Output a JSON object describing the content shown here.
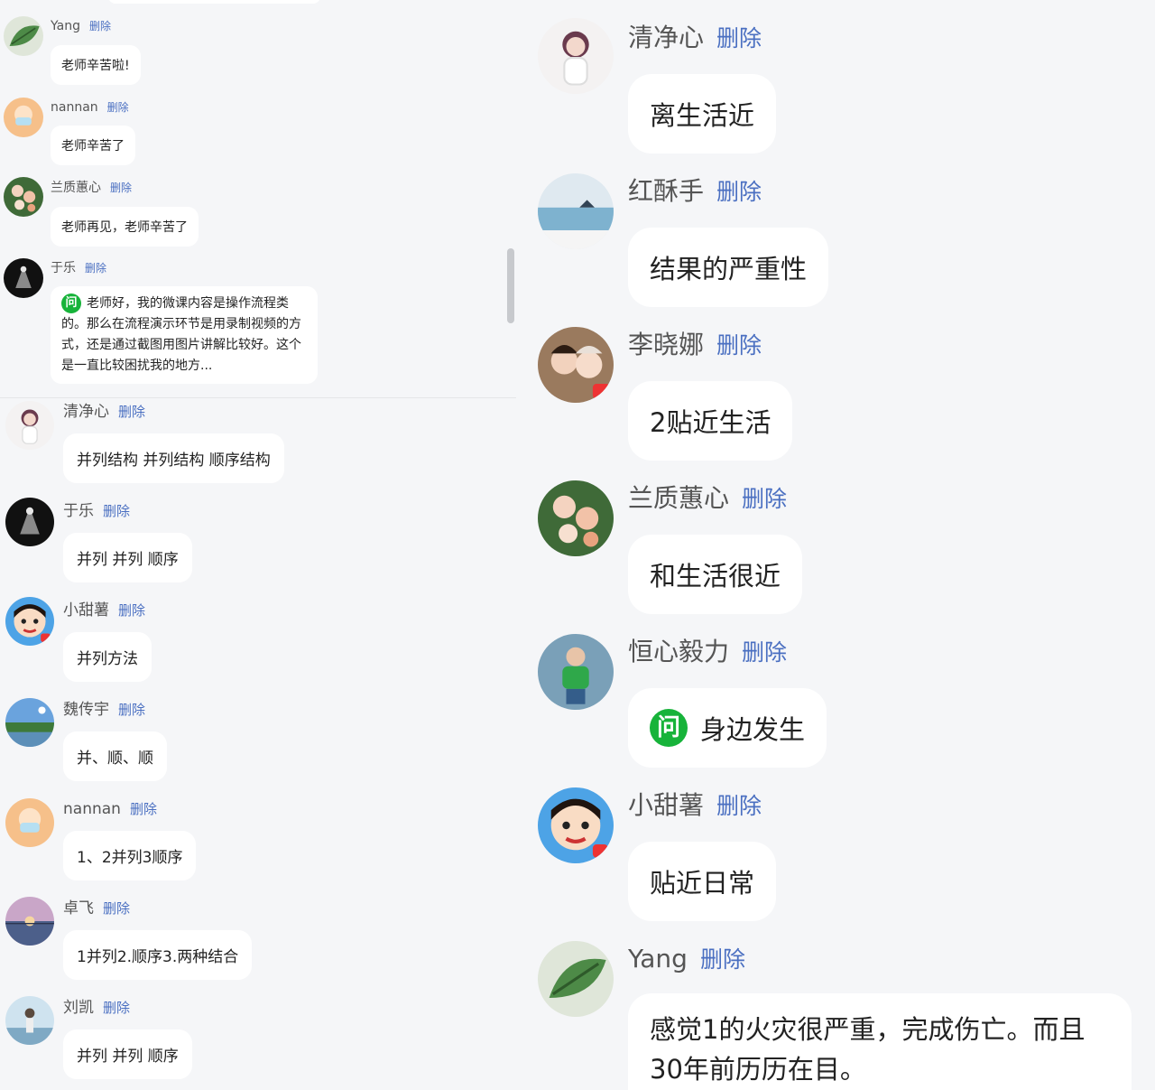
{
  "left_top": [
    {
      "user": "Yang",
      "text": "老师辛苦啦!",
      "avatar": "leaf-avatar"
    },
    {
      "user": "nannan",
      "text": "老师辛苦了",
      "avatar": "mask-avatar"
    },
    {
      "user": "兰质蕙心",
      "text": "老师再见，老师辛苦了",
      "avatar": "flower-avatar"
    },
    {
      "user": "于乐",
      "question_icon": "问",
      "text": "老师好，我的微课内容是操作流程类的。那么在流程演示环节是用录制视频的方式，还是通过截图用图片讲解比较好。这个是一直比较困扰我的地方...",
      "avatar": "dark-avatar"
    }
  ],
  "left_bottom": [
    {
      "user": "清净心",
      "text": "并列结构 并列结构 顺序结构",
      "avatar": "girl-avatar"
    },
    {
      "user": "于乐",
      "text": "并列 并列 顺序",
      "avatar": "dark-avatar"
    },
    {
      "user": "小甜薯",
      "text": "并列方法",
      "avatar": "cartoon-avatar"
    },
    {
      "user": "魏传宇",
      "text": "并、顺、顺",
      "avatar": "landscape-avatar"
    },
    {
      "user": "nannan",
      "text": "1、2并列3顺序",
      "avatar": "mask-avatar"
    },
    {
      "user": "卓飞",
      "text": "1并列2.顺序3.两种结合",
      "avatar": "sunset-avatar"
    },
    {
      "user": "刘凯",
      "text": "并列 并列 顺序",
      "avatar": "person-avatar"
    }
  ],
  "right": [
    {
      "user": "清净心",
      "text": "离生活近",
      "avatar": "girl-avatar"
    },
    {
      "user": "红酥手",
      "text": "结果的严重性",
      "avatar": "sea-avatar"
    },
    {
      "user": "李晓娜",
      "text": "2贴近生活",
      "avatar": "family-avatar"
    },
    {
      "user": "兰质蕙心",
      "text": "和生活很近",
      "avatar": "flower-avatar"
    },
    {
      "user": "恒心毅力",
      "question_icon": "问",
      "text": "身边发生",
      "avatar": "child-avatar"
    },
    {
      "user": "小甜薯",
      "text": "贴近日常",
      "avatar": "cartoon-avatar"
    },
    {
      "user": "Yang",
      "text": "感觉1的火灾很严重，完成伤亡。而且30年前历历在目。",
      "avatar": "leaf-avatar"
    }
  ],
  "delete_label": "删除",
  "colors": {
    "background": "#f5f6f8",
    "delete_link": "#4a6fc1",
    "question_icon": "#17b33a"
  }
}
